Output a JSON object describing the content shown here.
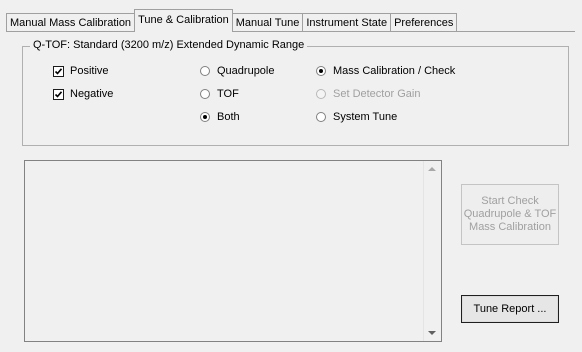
{
  "tabs": [
    {
      "label": "Manual Mass Calibration"
    },
    {
      "label": "Tune & Calibration",
      "active": true
    },
    {
      "label": "Manual Tune"
    },
    {
      "label": "Instrument State"
    },
    {
      "label": "Preferences"
    }
  ],
  "group": {
    "title": "Q-TOF:  Standard (3200 m/z) Extended Dynamic Range"
  },
  "polarity": {
    "positive": {
      "label": "Positive",
      "checked": true
    },
    "negative": {
      "label": "Negative",
      "checked": true
    }
  },
  "analyzer": {
    "quadrupole": {
      "label": "Quadrupole",
      "selected": false
    },
    "tof": {
      "label": "TOF",
      "selected": false
    },
    "both": {
      "label": "Both",
      "selected": true
    }
  },
  "mode": {
    "mass_calibration": {
      "label": "Mass Calibration / Check",
      "selected": true
    },
    "set_detector_gain": {
      "label": "Set Detector Gain",
      "selected": false,
      "disabled": true
    },
    "system_tune": {
      "label": "System Tune",
      "selected": false
    }
  },
  "log": {
    "text": ""
  },
  "buttons": {
    "start_check": "Start Check\nQuadrupole & TOF\nMass Calibration",
    "tune_report": "Tune Report ..."
  }
}
